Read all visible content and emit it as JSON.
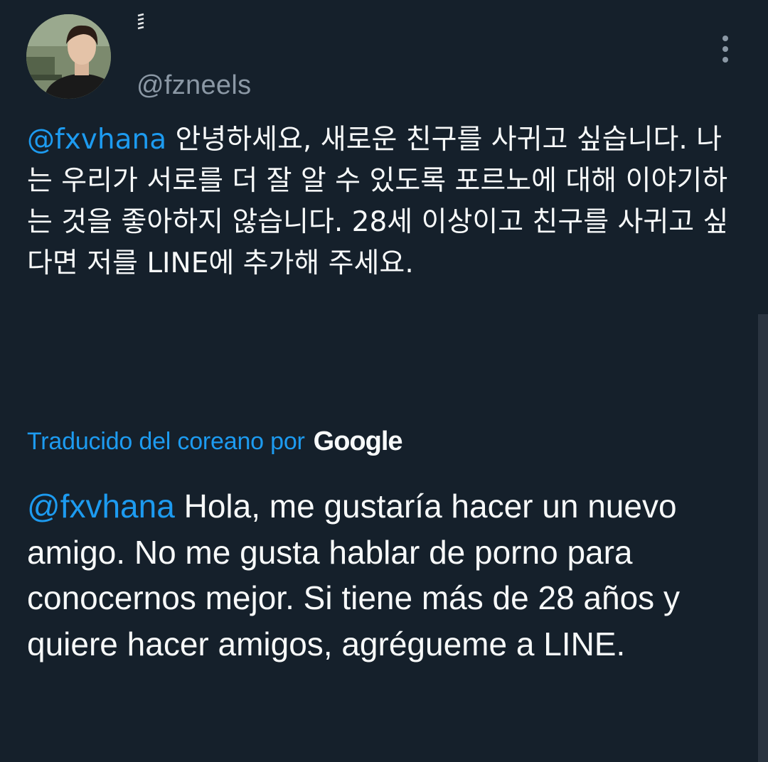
{
  "tweet": {
    "display_name": "𝄙",
    "handle": "@fzneels",
    "original": {
      "mention": "@fxvhana",
      "text": " 안녕하세요, 새로운 친구를 사귀고 싶습니다. 나는 우리가 서로를 더 잘 알 수 있도록 포르노에 대해 이야기하는 것을 좋아하지 않습니다. 28세 이상이고 친구를 사귀고 싶다면 저를 LINE에 추가해 주세요."
    },
    "translation_label": "Traducido del coreano por",
    "translation_provider": "Google",
    "translated": {
      "mention": "@fxvhana",
      "text": " Hola, me gustaría hacer un nuevo amigo. No me gusta hablar de porno para conocernos mejor. Si tiene más de 28 años y quiere hacer amigos, agrégueme a LINE."
    }
  },
  "icons": {
    "more": "more-vertical-icon"
  },
  "colors": {
    "background": "#15202b",
    "accent": "#1d9bf0",
    "secondary_text": "#8b98a5",
    "primary_text": "#f7f9f9"
  }
}
